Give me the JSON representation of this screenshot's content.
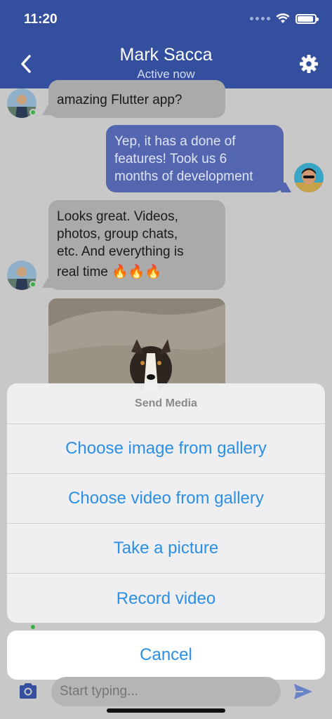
{
  "status_bar": {
    "time": "11:20"
  },
  "header": {
    "title": "Mark Sacca",
    "subtitle": "Active now"
  },
  "messages": [
    {
      "direction": "in",
      "text": "amazing Flutter app?"
    },
    {
      "direction": "out",
      "lines": [
        "Yep, it has a done of",
        "features! Took us 6",
        "months of development"
      ]
    },
    {
      "direction": "in",
      "lines": [
        "Looks great. Videos,",
        "photos, group chats,",
        "etc. And everything is",
        "real time 🔥🔥🔥"
      ]
    }
  ],
  "sheet": {
    "title": "Send Media",
    "options": [
      "Choose image from gallery",
      "Choose video from gallery",
      "Take a picture",
      "Record video"
    ],
    "cancel": "Cancel"
  },
  "composer": {
    "placeholder": "Start typing..."
  },
  "colors": {
    "header": "#354f9f",
    "outgoing_bubble": "#5566b0",
    "action": "#2d8fe3",
    "online": "#3cb043"
  }
}
